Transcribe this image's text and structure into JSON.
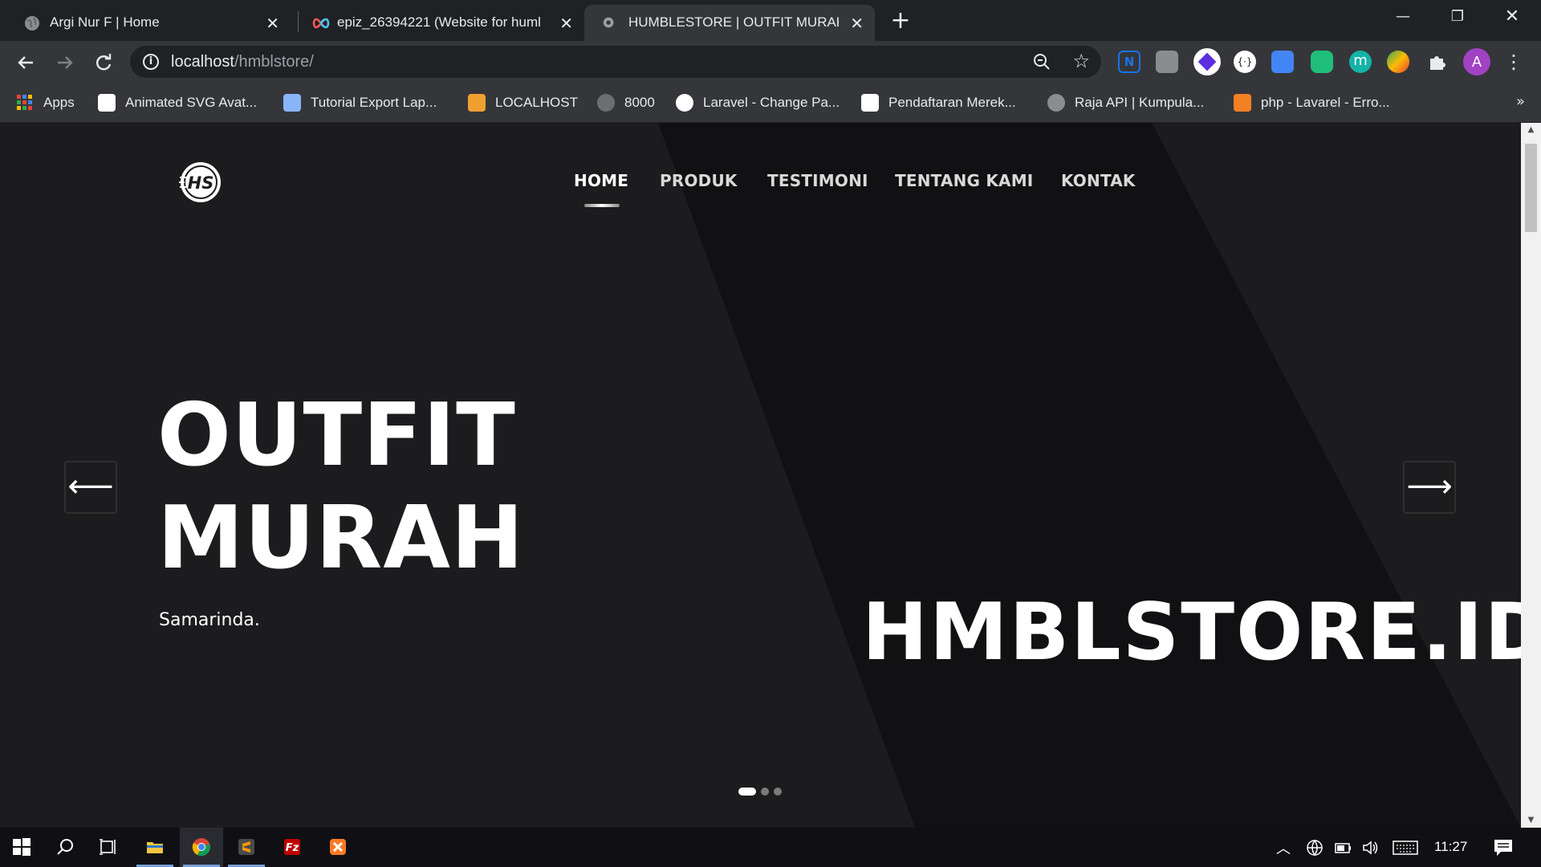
{
  "browser": {
    "tabs": [
      {
        "title": "Argi Nur F | Home",
        "favicon": "globe-icon",
        "active": false
      },
      {
        "title": "epiz_26394221 (Website for huml",
        "favicon": "infinityfree-icon",
        "active": false
      },
      {
        "title": "HUMBLESTORE | OUTFIT MURAH",
        "favicon": "site-icon",
        "active": true
      }
    ],
    "address": {
      "host": "localhost",
      "path": "/hmblstore/"
    },
    "bookmarks": [
      {
        "label": "Apps",
        "icon": "apps-grid-icon"
      },
      {
        "label": "Animated SVG Avat...",
        "icon": "codepen-icon"
      },
      {
        "label": "Tutorial Export Lap...",
        "icon": "bookmark-icon"
      },
      {
        "label": "LOCALHOST",
        "icon": "xampp-icon"
      },
      {
        "label": "8000",
        "icon": "laravel-icon"
      },
      {
        "label": "Laravel - Change Pa...",
        "icon": "hs-icon"
      },
      {
        "label": "Pendaftaran Merek...",
        "icon": "emblem-icon"
      },
      {
        "label": "Raja API | Kumpula...",
        "icon": "globe-icon"
      },
      {
        "label": "php - Lavarel - Erro...",
        "icon": "stackoverflow-icon"
      }
    ],
    "profile_initial": "A"
  },
  "site": {
    "nav": [
      "HOME",
      "PRODUK",
      "TESTIMONI",
      "TENTANG KAMI",
      "KONTAK"
    ],
    "active_nav": "HOME",
    "hero": {
      "line1": "OUTFIT",
      "line2": "MURAH",
      "subtitle": "Samarinda.",
      "brand": "HMBLSTORE.ID"
    },
    "prev_arrow": "⟵",
    "next_arrow": "⟶",
    "slides": 3,
    "active_slide": 1
  },
  "taskbar": {
    "clock": "11:27"
  },
  "colors": {
    "page_bg": "#1c1b1d",
    "chrome_dark": "#202124",
    "chrome_mid": "#35363a",
    "text_white": "#ffffff"
  }
}
